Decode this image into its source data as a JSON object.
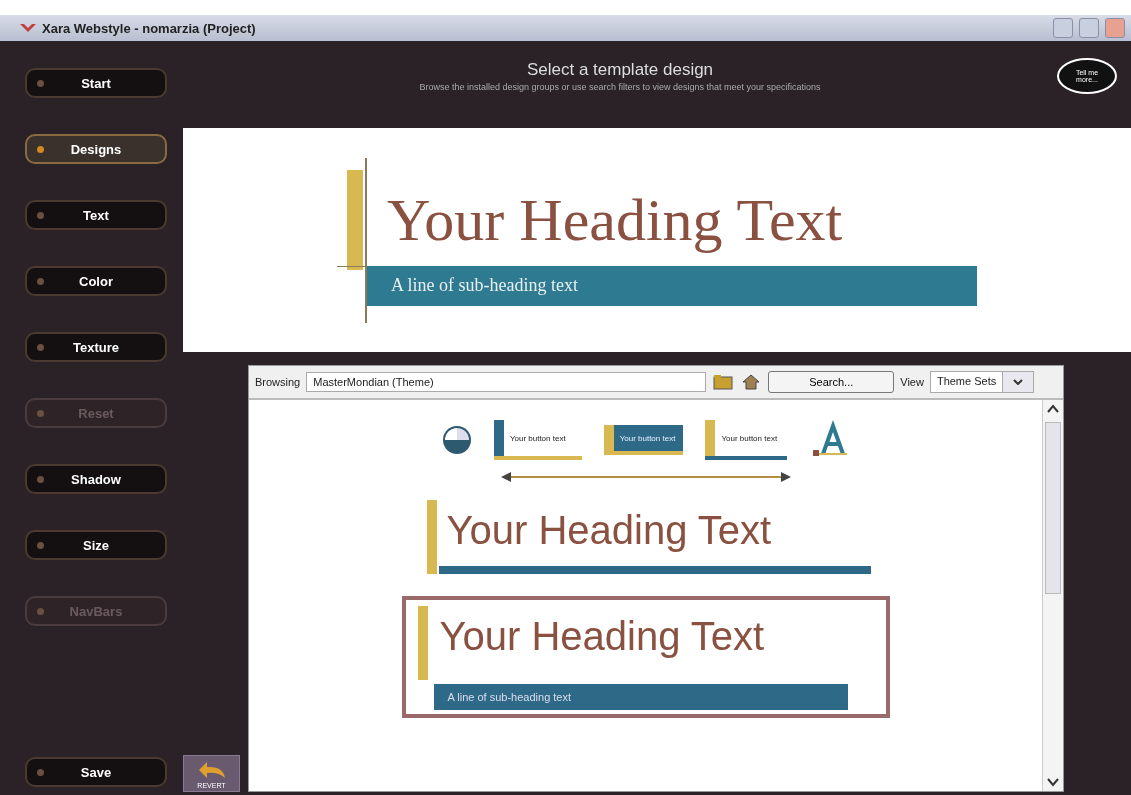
{
  "window": {
    "title": "Xara Webstyle - nomarzia (Project)"
  },
  "sidebar": {
    "items": [
      {
        "label": "Start",
        "selected": false,
        "disabled": false
      },
      {
        "label": "Designs",
        "selected": true,
        "disabled": false
      },
      {
        "label": "Text",
        "selected": false,
        "disabled": false
      },
      {
        "label": "Color",
        "selected": false,
        "disabled": false
      },
      {
        "label": "Texture",
        "selected": false,
        "disabled": false
      },
      {
        "label": "Reset",
        "selected": false,
        "disabled": true
      },
      {
        "label": "Shadow",
        "selected": false,
        "disabled": false
      },
      {
        "label": "Size",
        "selected": false,
        "disabled": false
      },
      {
        "label": "NavBars",
        "selected": false,
        "disabled": true
      }
    ],
    "save": "Save"
  },
  "header": {
    "title": "Select a template design",
    "subtitle": "Browse the installed design groups or use search filters to view designs that meet your specifications",
    "help": "Tell me more..."
  },
  "preview": {
    "heading": "Your Heading Text",
    "subheading": "A line of sub-heading text"
  },
  "revert": "REVERT",
  "browser": {
    "label": "Browsing",
    "path": "MasterMondian (Theme)",
    "search": "Search...",
    "view_label": "View",
    "view": "Theme Sets",
    "buttons": [
      {
        "label": "Your button text",
        "kind": "underline"
      },
      {
        "label": "Your button text",
        "kind": "filled"
      },
      {
        "label": "Your button text",
        "kind": "bar"
      }
    ],
    "designs": [
      {
        "heading": "Your Heading Text",
        "selected": false
      },
      {
        "heading": "Your Heading Text",
        "subheading": "A line of sub-heading text",
        "selected": true
      }
    ]
  }
}
